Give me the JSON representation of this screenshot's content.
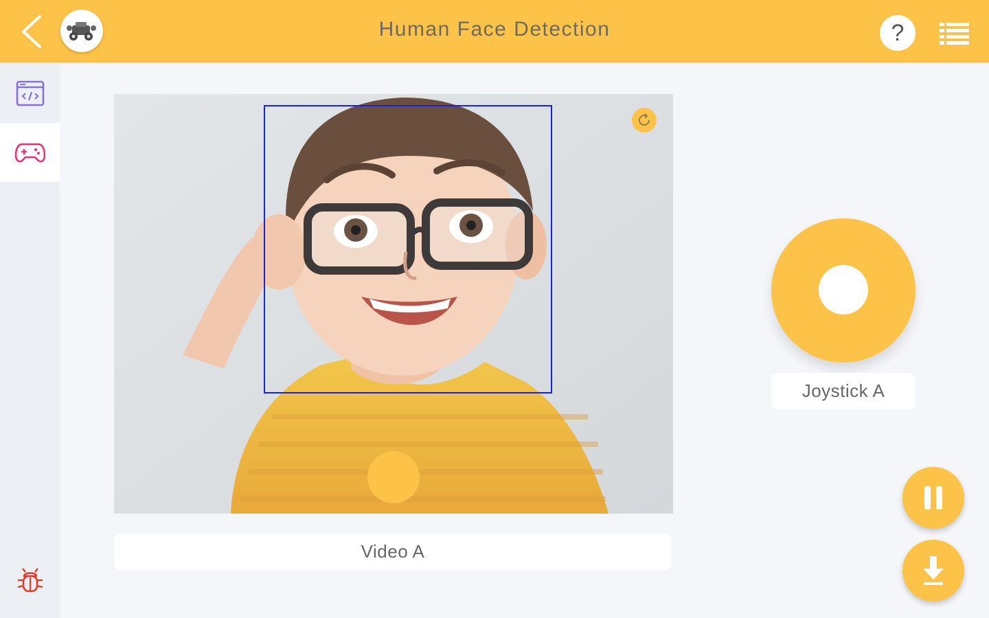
{
  "header": {
    "title": "Human Face Detection",
    "help_label": "?",
    "back_icon": "chevron-left-icon",
    "logo_icon": "robot-car-icon",
    "menu_icon": "list-menu-icon"
  },
  "sidebar": {
    "items": [
      {
        "icon": "code-window-icon",
        "active": false
      },
      {
        "icon": "gamepad-icon",
        "active": true
      }
    ],
    "bottom_icon": "bug-icon"
  },
  "video": {
    "label": "Video A",
    "face_box_color": "#1421e6",
    "refresh_icon": "refresh-icon"
  },
  "joystick": {
    "label": "Joystick A"
  },
  "controls": {
    "pause_icon": "pause-icon",
    "download_icon": "download-icon"
  },
  "colors": {
    "accent": "#fdc348",
    "sidebar_icon": "#8a6fd6",
    "active_icon": "#ec2f6e",
    "bug_icon": "#e23a2a"
  }
}
